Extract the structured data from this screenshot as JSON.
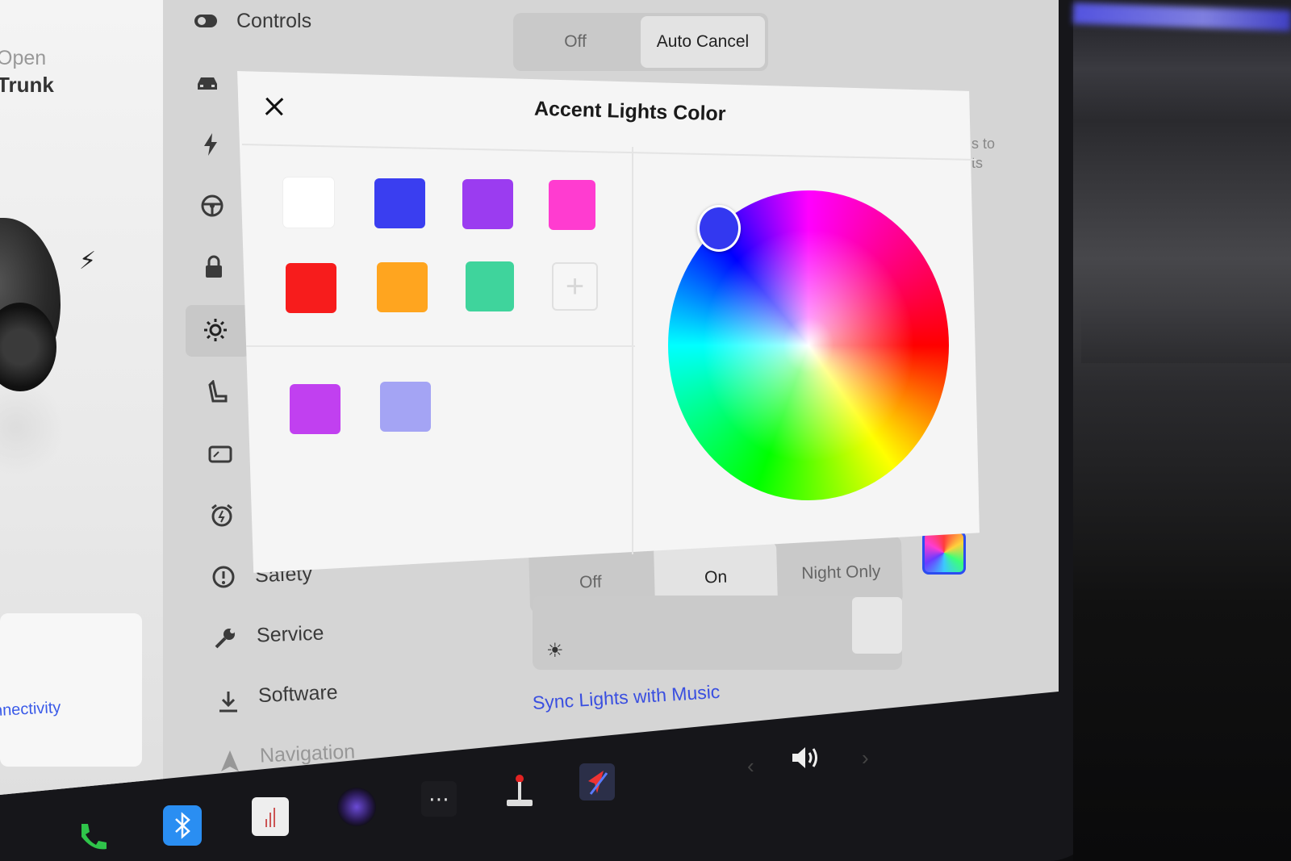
{
  "colors": {
    "accent": "#3a4fe0",
    "modal_bg": "#f5f5f5",
    "screen_bg": "#d5d5d5",
    "wheel_selector": "#3338f0"
  },
  "car_panel": {
    "open_label": "Open",
    "trunk_label": "Trunk",
    "connectivity_link": "nnectivity"
  },
  "sidebar": {
    "items": [
      {
        "label": "Controls",
        "icon": "toggle-icon"
      },
      {
        "label": "",
        "icon": "car-icon"
      },
      {
        "label": "",
        "icon": "bolt-icon"
      },
      {
        "label": "",
        "icon": "steering-wheel-icon"
      },
      {
        "label": "",
        "icon": "lock-icon"
      },
      {
        "label": "",
        "icon": "light-icon",
        "selected": true
      },
      {
        "label": "",
        "icon": "seat-icon"
      },
      {
        "label": "",
        "icon": "display-icon"
      },
      {
        "label": "",
        "icon": "alarm-icon"
      },
      {
        "label": "Safety",
        "icon": "alert-icon"
      },
      {
        "label": "Service",
        "icon": "wrench-icon"
      },
      {
        "label": "Software",
        "icon": "download-icon"
      },
      {
        "label": "Navigation",
        "icon": "navigation-icon"
      }
    ]
  },
  "main": {
    "top_seg": {
      "off": "Off",
      "auto_cancel": "Auto Cancel",
      "selected": "Auto Cancel"
    },
    "hint_line1": "s to",
    "hint_line2": "ts",
    "lights_seg": {
      "off": "Off",
      "on": "On",
      "night_only": "Night Only",
      "selected": "On"
    },
    "sync_link": "Sync Lights with Music"
  },
  "modal": {
    "title": "Accent Lights Color",
    "close_icon": "close-icon",
    "preset_colors": [
      "#ffffff",
      "#3a3ef0",
      "#9b3cf0",
      "#ff3cd0",
      "#f71c1c",
      "#ffa51f",
      "#3fd49c"
    ],
    "custom_colors": [
      "#c140f0",
      "#a4a4f4"
    ],
    "add_label": "+"
  },
  "taskbar": {
    "icons": [
      "phone-icon",
      "bluetooth-icon",
      "notepad-icon",
      "camera-icon",
      "more-icon",
      "joystick-icon",
      "navigation-app-icon"
    ],
    "volume_icon": "volume-icon"
  }
}
